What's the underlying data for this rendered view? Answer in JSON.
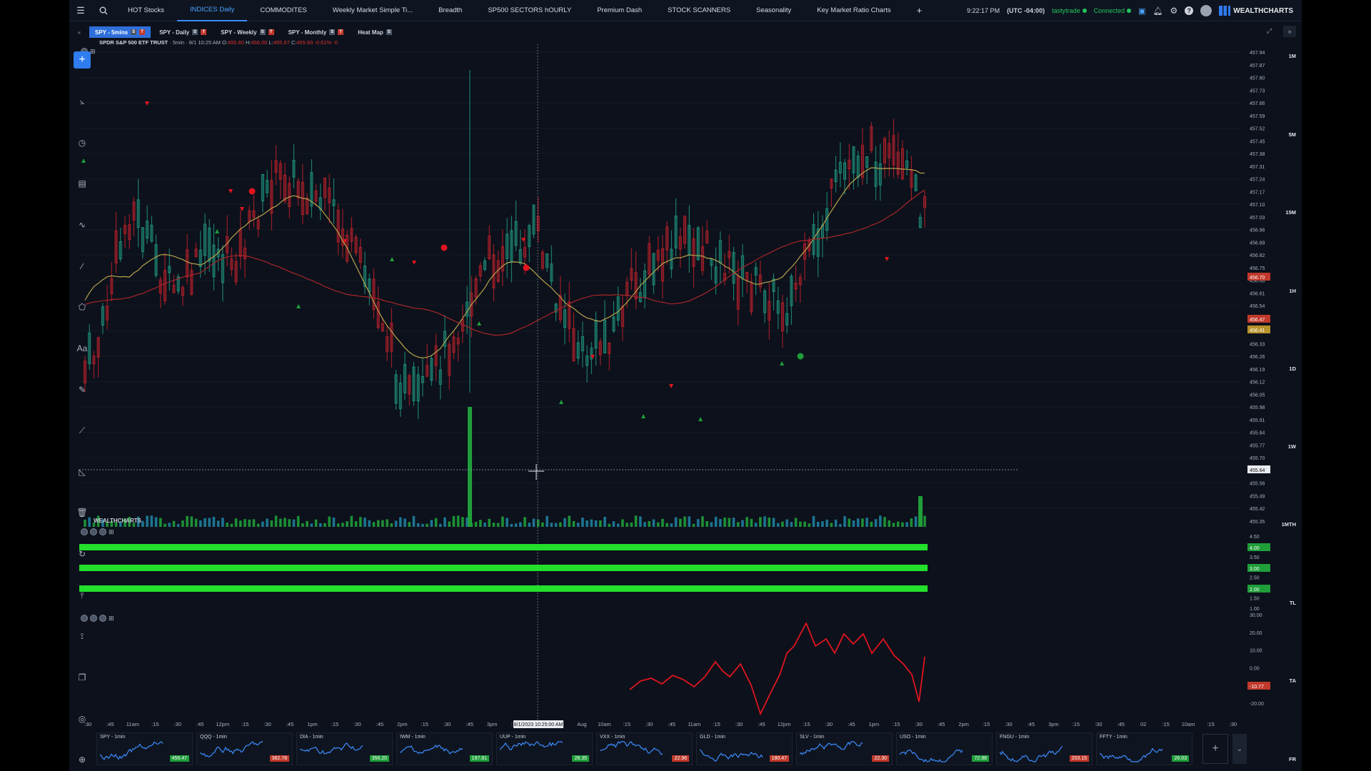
{
  "nav": {
    "tabs": [
      {
        "label": "HOT Stocks"
      },
      {
        "label": "INDICES Daily",
        "active": true
      },
      {
        "label": "COMMODITES"
      },
      {
        "label": "Weekly Market Simple Ti..."
      },
      {
        "label": "Breadth"
      },
      {
        "label": "SP500 SECTORS hOURLY"
      },
      {
        "label": "Premium Dash"
      },
      {
        "label": "STOCK SCANNERS"
      },
      {
        "label": "Seasonality"
      },
      {
        "label": "Key Market Ratio Charts"
      }
    ],
    "add_label": "+",
    "time": "9:22:17 PM",
    "timezone": "(UTC -04:00)",
    "broker": "tastytrade",
    "status": "Connected",
    "brand": "WEALTHCHARTS"
  },
  "subtabs": [
    {
      "label": "SPY - 5mins",
      "active": true,
      "badges": [
        "S",
        "T"
      ]
    },
    {
      "label": "SPY - Daily",
      "badges": [
        "S",
        "T"
      ]
    },
    {
      "label": "SPY - Weekly",
      "badges": [
        "S",
        "T"
      ]
    },
    {
      "label": "SPY - Monthly",
      "badges": [
        "S",
        "T"
      ]
    },
    {
      "label": "Heat Map",
      "badges": [
        "S"
      ]
    }
  ],
  "ticker": {
    "name": "SPDR S&P 500 ETF TRUST",
    "interval": "· 5min · 8/1 10:25 AM",
    "o_label": "O:",
    "o": "455.60",
    "h_label": "H:",
    "h": "456.00",
    "l_label": "L:",
    "l": "455.67",
    "c_label": "C:",
    "c": "455.93",
    "chg": "-0.61%",
    "chg2": "-0"
  },
  "timeframes": [
    "1M",
    "5M",
    "15M",
    "1H",
    "1D",
    "1W",
    "1MTH",
    "TL",
    "TA",
    "FR"
  ],
  "price_axis": [
    "457.94",
    "457.87",
    "457.80",
    "457.73",
    "457.66",
    "457.59",
    "457.52",
    "457.45",
    "457.38",
    "457.31",
    "457.24",
    "457.17",
    "457.10",
    "457.03",
    "456.96",
    "456.89",
    "456.82",
    "456.75",
    "456.68",
    "456.61",
    "456.54",
    "456.47",
    "456.40",
    "456.33",
    "456.26",
    "456.19",
    "456.12",
    "456.05",
    "455.98",
    "455.91",
    "455.84",
    "455.77",
    "455.70",
    "455.63",
    "455.56",
    "455.49",
    "455.42",
    "455.35"
  ],
  "price_badges": {
    "red1": "456.70",
    "red2": "456.47",
    "gold": "456.41",
    "cursor": "455.64"
  },
  "ind1_axis": [
    "4.50",
    "4.00",
    "3.50",
    "3.00",
    "2.50",
    "2.00",
    "1.50",
    "1.00"
  ],
  "ind1_badges": [
    "4.00",
    "3.00",
    "2.00"
  ],
  "ind2_axis": [
    "30.00",
    "20.00",
    "10.00",
    "0.00",
    "-10.00",
    "-20.00"
  ],
  "ind2_badge": "-10.77",
  "watermark": "WEALTHCHARTS",
  "time_axis": [
    ":30",
    ":45",
    "11am",
    ":15",
    ":30",
    ":45",
    "12pm",
    ":15",
    ":30",
    ":45",
    "1pm",
    ":15",
    ":30",
    ":45",
    "2pm",
    ":15",
    ":30",
    ":45",
    "3pm",
    ":15",
    ":30",
    ":45",
    "Aug",
    "10am",
    ":15",
    ":30",
    ":45",
    "11am",
    ":15",
    ":30",
    ":45",
    "12pm",
    ":15",
    ":30",
    ":45",
    "1pm",
    ":15",
    ":30",
    ":45",
    "2pm",
    ":15",
    ":30",
    ":45",
    "3pm",
    ":15",
    ":30",
    ":45",
    "02",
    ":15",
    "10am",
    ":15",
    ":30"
  ],
  "cursor_time": "8/1/2023 10:25:00 AM",
  "minis": [
    {
      "label": "SPY - 1min",
      "value": "456.47",
      "color": "#1f9e3a"
    },
    {
      "label": "QQQ - 1min",
      "value": "382.78",
      "color": "#c0392b"
    },
    {
      "label": "DIA - 1min",
      "value": "356.20",
      "color": "#1f9e3a"
    },
    {
      "label": "IWM - 1min",
      "value": "197.81",
      "color": "#1f9e3a"
    },
    {
      "label": "UUP - 1min",
      "value": "28.35",
      "color": "#1f9e3a"
    },
    {
      "label": "VXX - 1min",
      "value": "22.96",
      "color": "#c0392b"
    },
    {
      "label": "GLD - 1min",
      "value": "180.47",
      "color": "#c0392b"
    },
    {
      "label": "SLV - 1min",
      "value": "22.30",
      "color": "#c0392b"
    },
    {
      "label": "USO - 1min",
      "value": "72.98",
      "color": "#1f9e3a"
    },
    {
      "label": "FNGU - 1min",
      "value": "203.15",
      "color": "#c0392b"
    },
    {
      "label": "FFTY - 1min",
      "value": "26.03",
      "color": "#1f9e3a"
    }
  ]
}
